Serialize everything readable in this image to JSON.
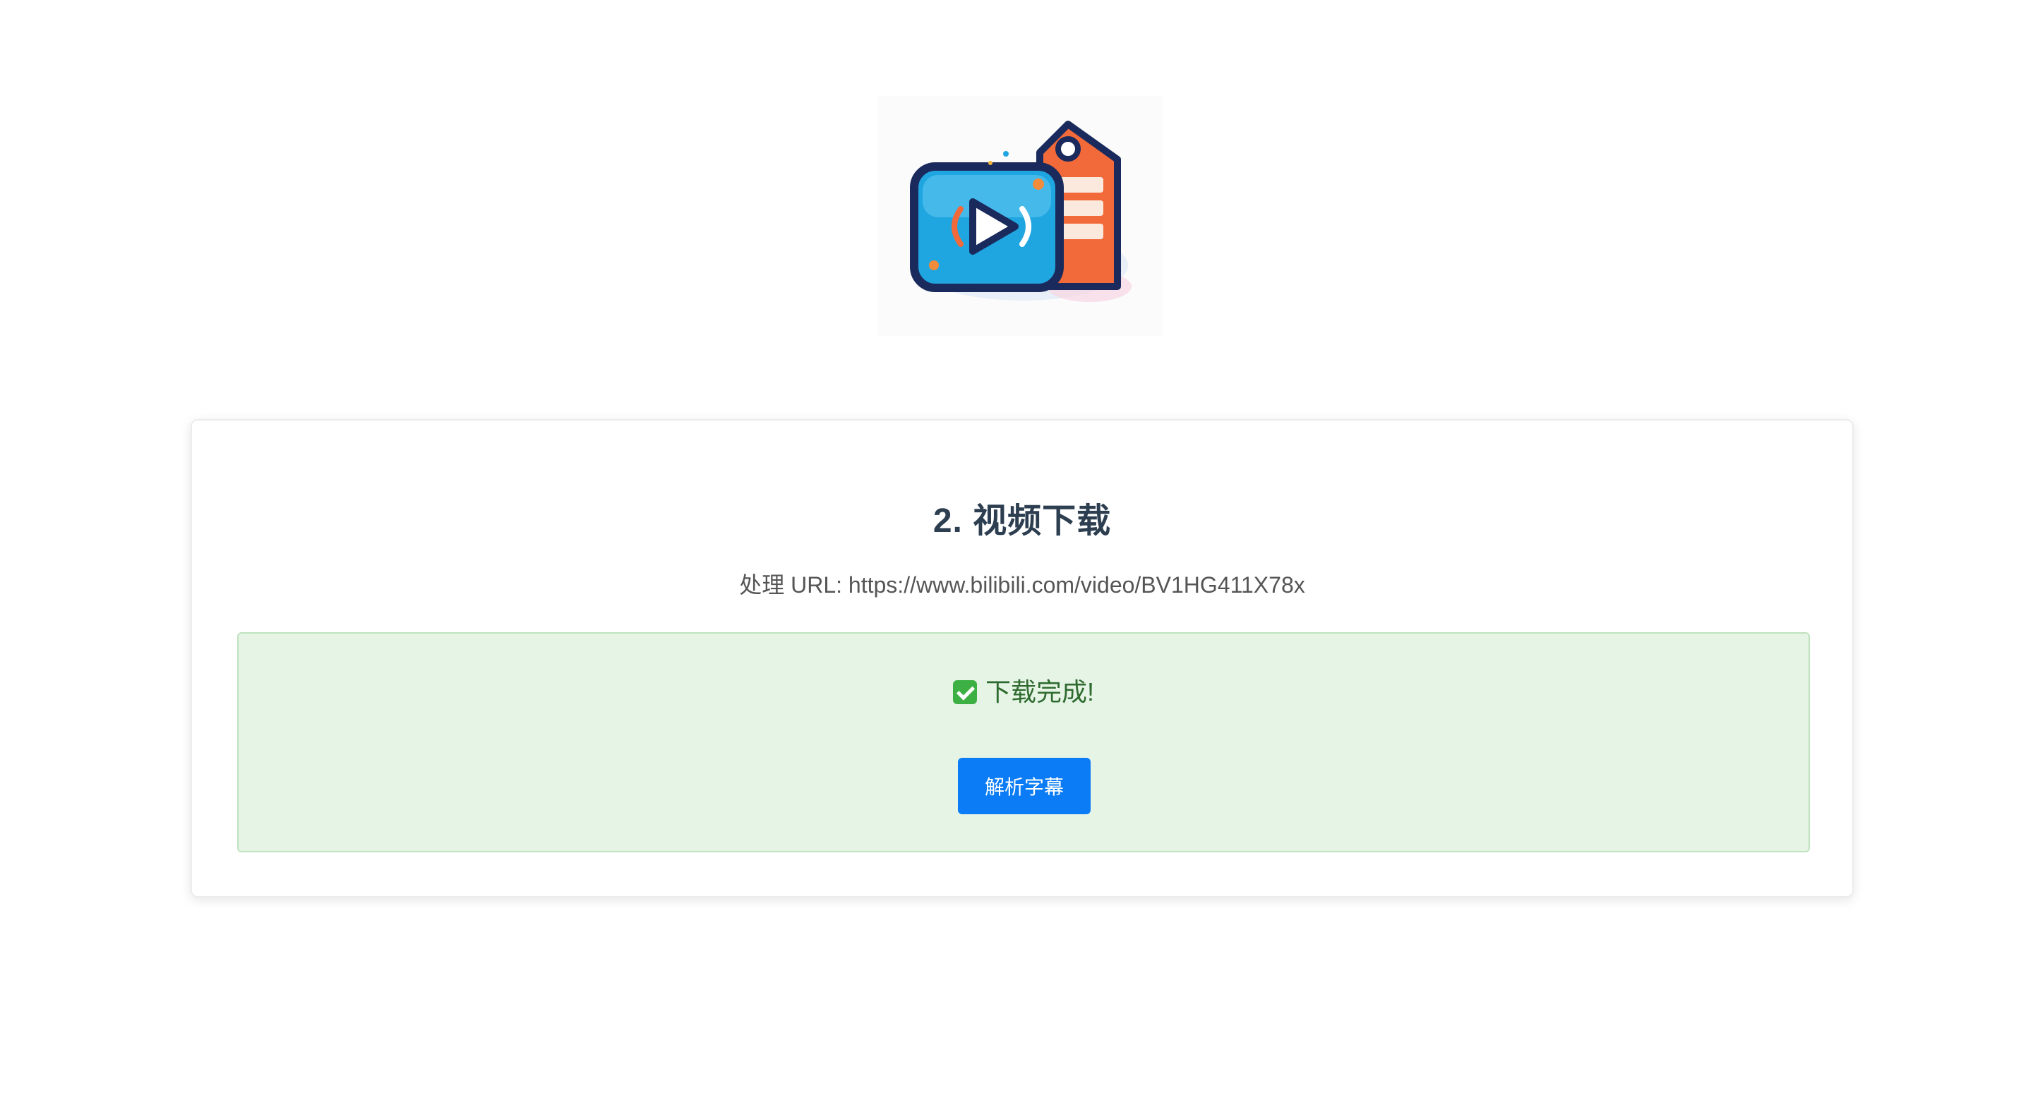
{
  "logo": {
    "icon": "video-subtitle-tag-icon",
    "colors": {
      "screen": "#1fa5e0",
      "frame": "#1a2a5c",
      "tag": "#f26a3a"
    }
  },
  "card": {
    "title": "2. 视频下载",
    "url_line": "处理 URL: https://www.bilibili.com/video/BV1HG411X78x"
  },
  "status": {
    "icon": "check-mark-icon",
    "message": "下载完成!",
    "button_label": "解析字幕"
  },
  "colors": {
    "accent": "#0b7cf5",
    "success_bg": "#e6f4e6",
    "success_border": "#bfe3bf",
    "title": "#2c3e50"
  }
}
